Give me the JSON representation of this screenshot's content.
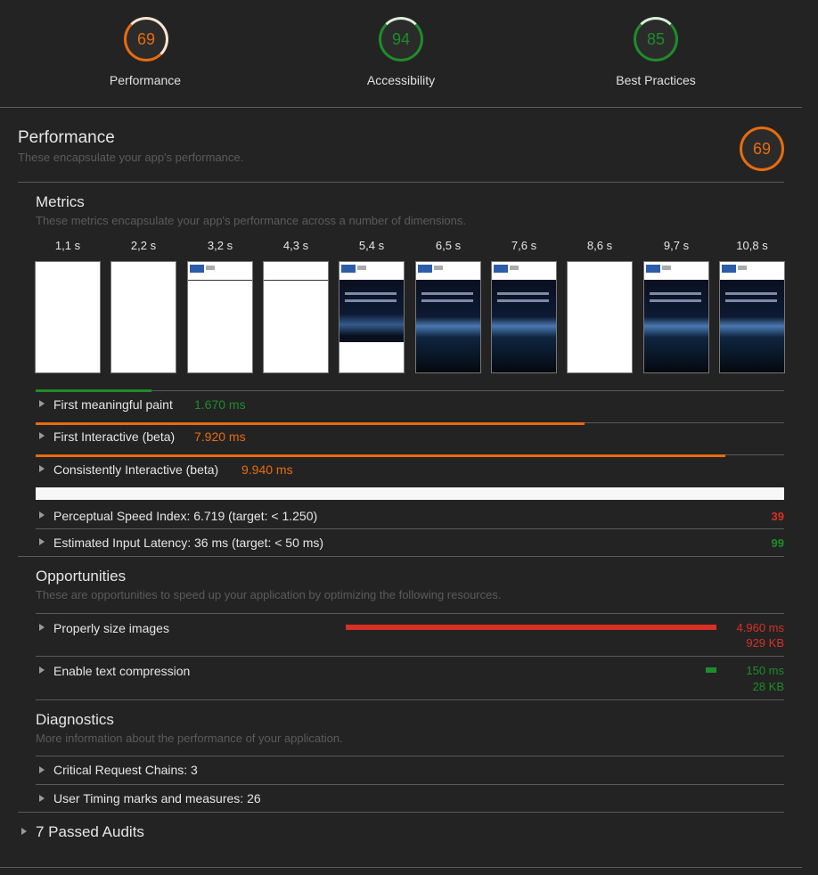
{
  "summary": [
    {
      "score": "69",
      "label": "Performance"
    },
    {
      "score": "94",
      "label": "Accessibility"
    },
    {
      "score": "85",
      "label": "Best Practices"
    }
  ],
  "performance": {
    "title": "Performance",
    "subtitle": "These encapsulate your app's performance.",
    "score": "69"
  },
  "metrics": {
    "title": "Metrics",
    "subtitle": "These metrics encapsulate your app's performance across a number of dimensions.",
    "frames": [
      "1,1 s",
      "2,2 s",
      "3,2 s",
      "4,3 s",
      "5,4 s",
      "6,5 s",
      "7,6 s",
      "8,6 s",
      "9,7 s",
      "10,8 s"
    ],
    "timeline": [
      {
        "label": "First meaningful paint",
        "value": "1.670 ms",
        "fraction": 0.155
      },
      {
        "label": "First Interactive (beta)",
        "value": "7.920 ms",
        "fraction": 0.735
      },
      {
        "label": "Consistently Interactive (beta)",
        "value": "9.940 ms",
        "fraction": 0.922
      }
    ],
    "scored": [
      {
        "label": "Perceptual Speed Index: 6.719 (target: < 1.250)",
        "score": "39"
      },
      {
        "label": "Estimated Input Latency: 36 ms (target: < 50 ms)",
        "score": "99"
      }
    ]
  },
  "opportunities": {
    "title": "Opportunities",
    "subtitle": "These are opportunities to speed up your application by optimizing the following resources.",
    "items": [
      {
        "label": "Properly size images",
        "time": "4.960 ms",
        "size": "929 KB",
        "fraction": 0.98
      },
      {
        "label": "Enable text compression",
        "time": "150 ms",
        "size": "28 KB",
        "fraction": 0.03
      }
    ]
  },
  "diagnostics": {
    "title": "Diagnostics",
    "subtitle": "More information about the performance of your application.",
    "items": [
      "Critical Request Chains: 3",
      "User Timing marks and measures: 26"
    ]
  },
  "passed": {
    "label": "7 Passed Audits"
  },
  "colors": {
    "good": "#1e8c2a",
    "average": "#e76c0f",
    "poor": "#d93025"
  }
}
